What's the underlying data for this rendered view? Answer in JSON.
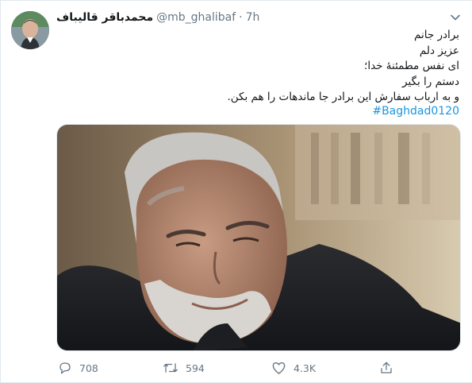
{
  "tweet": {
    "display_name": "محمدباقر قالیباف",
    "handle": "@mb_ghalibaf",
    "separator": "·",
    "time": "7h",
    "lines": [
      "برادر جانم",
      "عزیز دلم",
      "ای نفس مطمئنهٔ خدا؛",
      "دستم را بگیر",
      "و به ارباب سفارش این برادر جا ماندهات را هم بکن."
    ],
    "hashtag": "#Baghdad0120"
  },
  "actions": {
    "reply_count": "708",
    "retweet_count": "594",
    "like_count": "4.3K"
  },
  "colors": {
    "link": "#1b95e0",
    "secondary_text": "#657786",
    "border": "#e1e8ed"
  }
}
